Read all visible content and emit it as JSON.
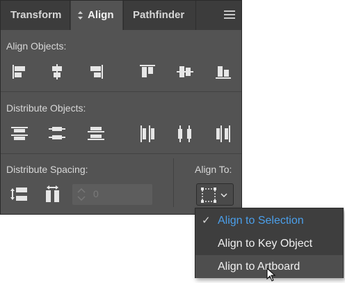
{
  "tabs": [
    {
      "label": "Transform"
    },
    {
      "label": "Align"
    },
    {
      "label": "Pathfinder"
    }
  ],
  "sections": {
    "align_objects": {
      "label": "Align Objects:"
    },
    "distribute_objects": {
      "label": "Distribute Objects:"
    },
    "distribute_spacing": {
      "label": "Distribute Spacing:"
    },
    "align_to": {
      "label": "Align To:"
    }
  },
  "spacing": {
    "value": "0"
  },
  "dropdown": {
    "items": [
      {
        "label": "Align to Selection",
        "selected": true
      },
      {
        "label": "Align to Key Object",
        "selected": false
      },
      {
        "label": "Align to Artboard",
        "selected": false
      }
    ],
    "check_glyph": "✓"
  },
  "colors": {
    "panel_bg": "#535353",
    "tabbar_bg": "#3c3c3c",
    "selected_item": "#4b9fea",
    "icon_light": "#e6e6e6"
  },
  "icons": [
    "horizontal-align-left-icon",
    "horizontal-align-center-icon",
    "horizontal-align-right-icon",
    "vertical-align-top-icon",
    "vertical-align-center-icon",
    "vertical-align-bottom-icon",
    "vertical-distribute-top-icon",
    "vertical-distribute-center-icon",
    "vertical-distribute-bottom-icon",
    "horizontal-distribute-left-icon",
    "horizontal-distribute-center-icon",
    "horizontal-distribute-right-icon",
    "vertical-distribute-space-icon",
    "horizontal-distribute-space-icon",
    "align-to-selection-icon"
  ]
}
